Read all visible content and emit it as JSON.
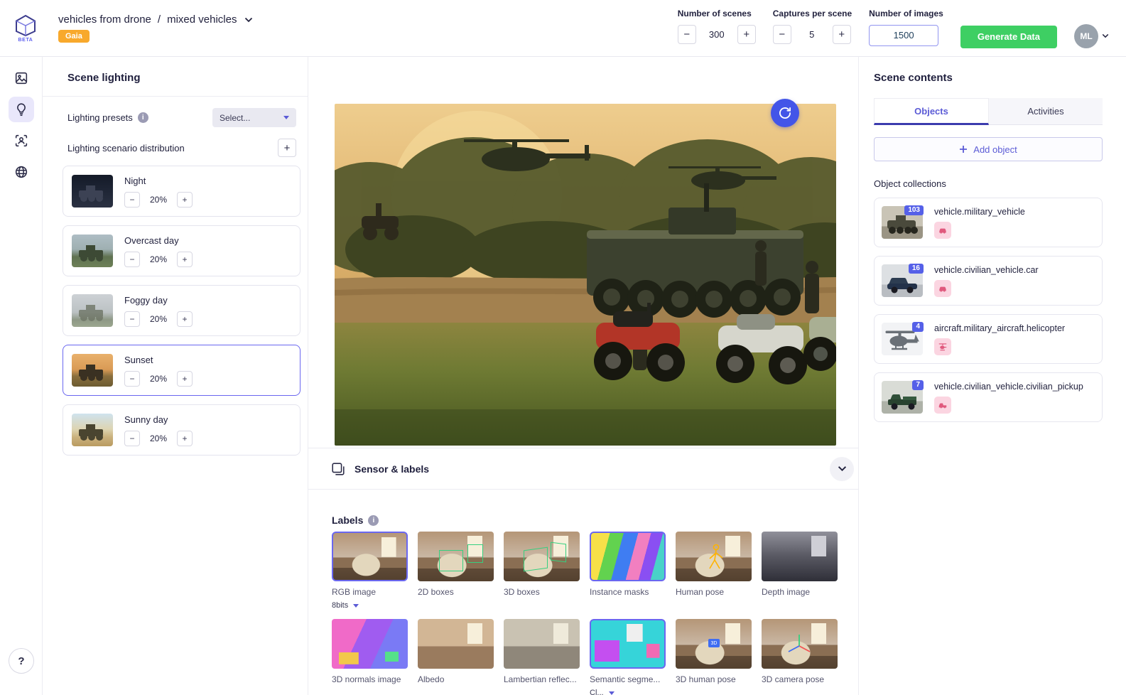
{
  "colors": {
    "accent_purple": "#5d5fef",
    "green_button": "#3ecf63",
    "orange_badge": "#f8a92c",
    "refresh_blue": "#4355e8",
    "selected_border": "#6a67f0"
  },
  "glyphs": {
    "minus": "−",
    "plus": "+"
  },
  "header": {
    "beta": "BETA",
    "breadcrumb_project": "vehicles from drone",
    "breadcrumb_separator": "/",
    "breadcrumb_scenario": "mixed vehicles",
    "gaia_badge": "Gaia",
    "scenes_label": "Number of scenes",
    "scenes_value": "300",
    "captures_label": "Captures per scene",
    "captures_value": "5",
    "images_label": "Number of images",
    "images_value": "1500",
    "generate_button": "Generate Data",
    "avatar_initials": "ML"
  },
  "lighting": {
    "title": "Scene lighting",
    "presets_label": "Lighting presets",
    "presets_value": "Select...",
    "distribution_label": "Lighting scenario distribution",
    "scenarios": [
      {
        "name": "Night",
        "percent": "20%",
        "selected": false
      },
      {
        "name": "Overcast day",
        "percent": "20%",
        "selected": false
      },
      {
        "name": "Foggy day",
        "percent": "20%",
        "selected": false
      },
      {
        "name": "Sunset",
        "percent": "20%",
        "selected": true
      },
      {
        "name": "Sunny day",
        "percent": "20%",
        "selected": false
      }
    ]
  },
  "sensor_bar": {
    "title": "Sensor & labels"
  },
  "labels_section": {
    "title": "Labels",
    "row1": [
      {
        "name": "RGB image",
        "option": "8bits",
        "selected": true
      },
      {
        "name": "2D boxes",
        "selected": false
      },
      {
        "name": "3D boxes",
        "selected": false
      },
      {
        "name": "Instance masks",
        "selected": true
      },
      {
        "name": "Human pose",
        "selected": false
      },
      {
        "name": "Depth image",
        "selected": false
      }
    ],
    "row2": [
      {
        "name": "3D normals image",
        "selected": false
      },
      {
        "name": "Albedo",
        "selected": false
      },
      {
        "name": "Lambertian reflec...",
        "selected": false
      },
      {
        "name": "Semantic segme...",
        "option": "Cl...",
        "selected": true
      },
      {
        "name": "3D human pose",
        "selected": false
      },
      {
        "name": "3D camera pose",
        "selected": false
      }
    ]
  },
  "scene_contents": {
    "title": "Scene contents",
    "tabs": {
      "objects": "Objects",
      "activities": "Activities"
    },
    "add_object_button": "Add object",
    "collections_label": "Object collections",
    "collections": [
      {
        "count": "103",
        "name": "vehicle.military_vehicle",
        "tag_icon": "car-icon"
      },
      {
        "count": "16",
        "name": "vehicle.civilian_vehicle.car",
        "tag_icon": "car-icon"
      },
      {
        "count": "4",
        "name": "aircraft.military_aircraft.helicopter",
        "tag_icon": "helicopter-icon"
      },
      {
        "count": "7",
        "name": "vehicle.civilian_vehicle.civilian_pickup",
        "tag_icon": "pickup-icon"
      }
    ]
  }
}
